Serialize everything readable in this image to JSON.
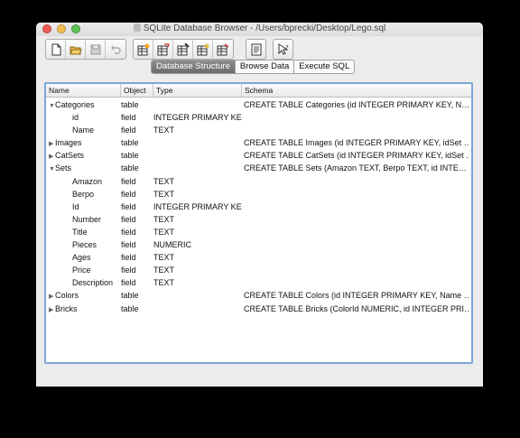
{
  "window": {
    "title": "SQLite Database Browser - /Users/bprecki/Desktop/Lego.sql"
  },
  "toolbar": {
    "groups": [
      [
        "new-file-icon",
        "open-folder-icon",
        "save-icon",
        "undo-icon"
      ],
      [
        "create-table-icon",
        "modify-table-icon",
        "delete-table-icon",
        "create-index-icon",
        "delete-index-icon"
      ],
      [
        "log-window-icon"
      ],
      [
        "whats-this-icon"
      ]
    ]
  },
  "tabs": [
    {
      "label": "Database Structure",
      "active": true
    },
    {
      "label": "Browse Data",
      "active": false
    },
    {
      "label": "Execute SQL",
      "active": false
    }
  ],
  "table": {
    "headers": {
      "name": "Name",
      "object": "Object",
      "type": "Type",
      "schema": "Schema"
    },
    "rows": [
      {
        "name": "Categories",
        "object": "table",
        "type": "",
        "schema": "CREATE TABLE Categories (id INTEGER PRIMARY KEY, N…",
        "level": 0,
        "expander": "open"
      },
      {
        "name": "id",
        "object": "field",
        "type": "INTEGER PRIMARY KEY",
        "schema": "",
        "level": 1,
        "expander": "none"
      },
      {
        "name": "Name",
        "object": "field",
        "type": "TEXT",
        "schema": "",
        "level": 1,
        "expander": "none"
      },
      {
        "name": "Images",
        "object": "table",
        "type": "",
        "schema": "CREATE TABLE Images (id INTEGER PRIMARY KEY, idSet …",
        "level": 0,
        "expander": "closed"
      },
      {
        "name": "CatSets",
        "object": "table",
        "type": "",
        "schema": "CREATE TABLE CatSets (id INTEGER PRIMARY KEY, idSet …",
        "level": 0,
        "expander": "closed"
      },
      {
        "name": "Sets",
        "object": "table",
        "type": "",
        "schema": "CREATE TABLE Sets (Amazon TEXT, Berpo TEXT, id INTE…",
        "level": 0,
        "expander": "open"
      },
      {
        "name": "Amazon",
        "object": "field",
        "type": "TEXT",
        "schema": "",
        "level": 1,
        "expander": "none"
      },
      {
        "name": "Berpo",
        "object": "field",
        "type": "TEXT",
        "schema": "",
        "level": 1,
        "expander": "none"
      },
      {
        "name": "Id",
        "object": "field",
        "type": "INTEGER PRIMARY KEY",
        "schema": "",
        "level": 1,
        "expander": "none"
      },
      {
        "name": "Number",
        "object": "field",
        "type": "TEXT",
        "schema": "",
        "level": 1,
        "expander": "none"
      },
      {
        "name": "Title",
        "object": "field",
        "type": "TEXT",
        "schema": "",
        "level": 1,
        "expander": "none"
      },
      {
        "name": "Pieces",
        "object": "field",
        "type": "NUMERIC",
        "schema": "",
        "level": 1,
        "expander": "none"
      },
      {
        "name": "Ages",
        "object": "field",
        "type": "TEXT",
        "schema": "",
        "level": 1,
        "expander": "none"
      },
      {
        "name": "Price",
        "object": "field",
        "type": "TEXT",
        "schema": "",
        "level": 1,
        "expander": "none"
      },
      {
        "name": "Description",
        "object": "field",
        "type": "TEXT",
        "schema": "",
        "level": 1,
        "expander": "none"
      },
      {
        "name": "Colors",
        "object": "table",
        "type": "",
        "schema": "CREATE TABLE Colors (id INTEGER PRIMARY KEY, Name …",
        "level": 0,
        "expander": "closed"
      },
      {
        "name": "Bricks",
        "object": "table",
        "type": "",
        "schema": "CREATE TABLE Bricks (ColorId NUMERIC, id INTEGER PRI…",
        "level": 0,
        "expander": "closed"
      }
    ]
  },
  "colors": {
    "focus_border": "#7ea7d8",
    "active_tab": "#7a7a7a"
  }
}
